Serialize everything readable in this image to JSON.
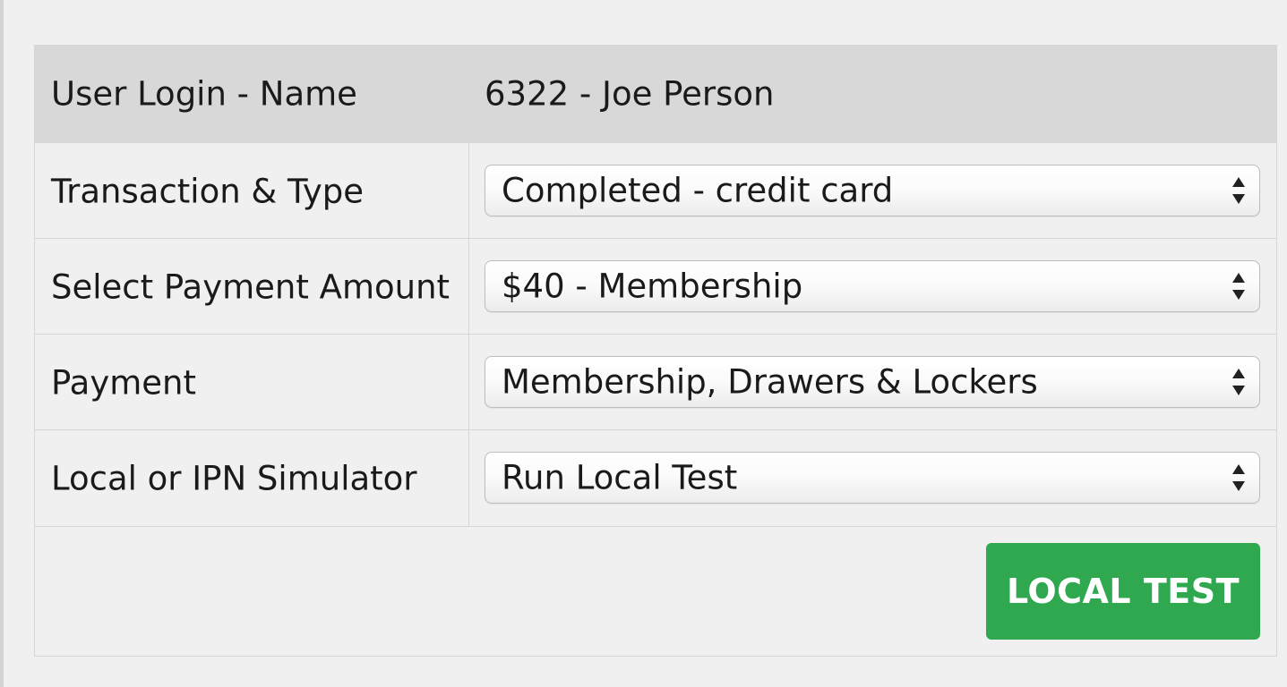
{
  "form": {
    "header": {
      "label": "User Login - Name",
      "value": "6322 - Joe Person"
    },
    "fields": [
      {
        "label": "Transaction & Type",
        "selected": "Completed - credit card"
      },
      {
        "label": "Select Payment Amount",
        "selected": "$40 - Membership"
      },
      {
        "label": "Payment",
        "selected": "Membership, Drawers & Lockers"
      },
      {
        "label": "Local or IPN Simulator",
        "selected": "Run Local Test"
      }
    ],
    "submit_label": "LOCAL TEST"
  },
  "colors": {
    "button": "#2fa84f",
    "header_row": "#d8d8d8",
    "background": "#f0f0f0"
  },
  "icons": {
    "select_arrows": "up-down-chevron-icon"
  }
}
